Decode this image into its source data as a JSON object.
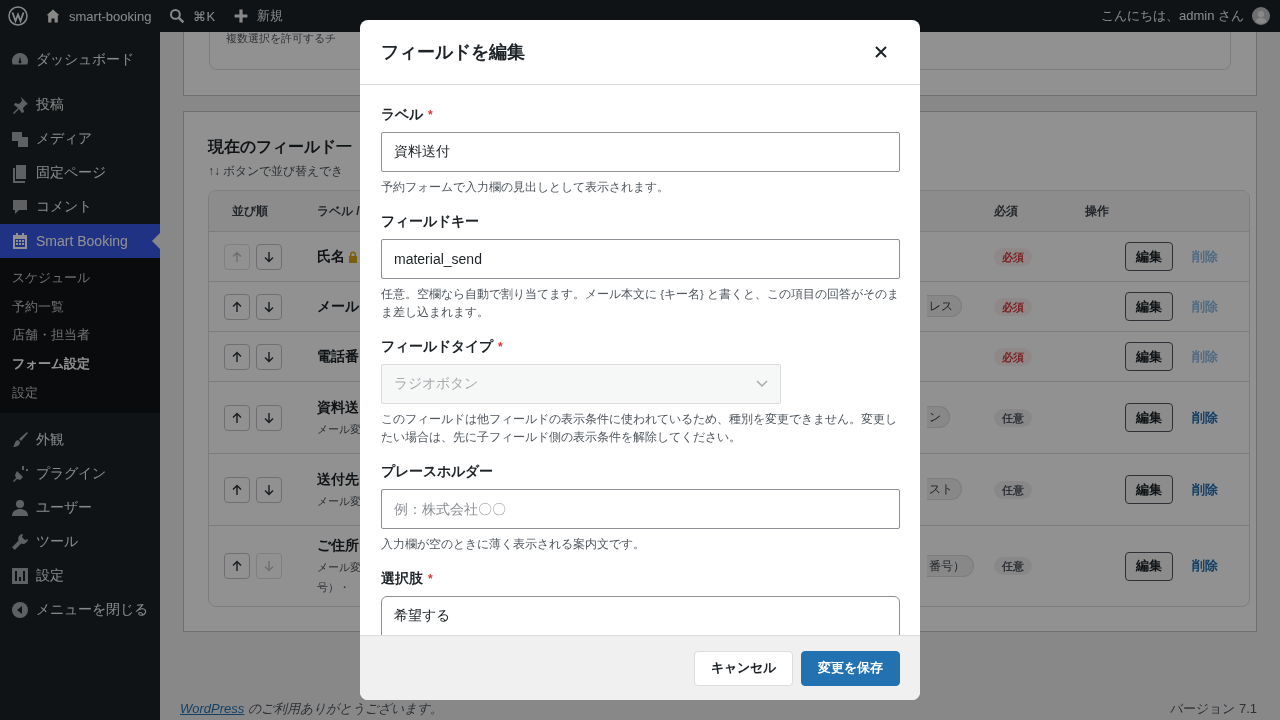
{
  "admin_bar": {
    "site_name": "smart-booking",
    "search_shortcut": "⌘K",
    "new_label": "新規",
    "greeting": "こんにちは、admin さん"
  },
  "sidebar": {
    "items": [
      {
        "label": "ダッシュボード",
        "selected": false
      },
      {
        "label": "投稿",
        "selected": false
      },
      {
        "label": "メディア",
        "selected": false
      },
      {
        "label": "固定ページ",
        "selected": false
      },
      {
        "label": "コメント",
        "selected": false
      },
      {
        "label": "Smart Booking",
        "selected": true,
        "children": [
          {
            "label": "スケジュール",
            "selected": false
          },
          {
            "label": "予約一覧",
            "selected": false
          },
          {
            "label": "店舗・担当者",
            "selected": false
          },
          {
            "label": "フォーム設定",
            "selected": true
          },
          {
            "label": "設定",
            "selected": false
          }
        ]
      },
      {
        "label": "外観",
        "selected": false
      },
      {
        "label": "プラグイン",
        "selected": false
      },
      {
        "label": "ユーザー",
        "selected": false
      },
      {
        "label": "ツール",
        "selected": false
      },
      {
        "label": "設定",
        "selected": false
      }
    ],
    "collapse_label": "メニューを閉じる"
  },
  "content": {
    "top_card_text": "複数選択を許可するチ",
    "fields_card": {
      "title": "現在のフィールド一",
      "subtitle": "↑↓ ボタンで並び替えでき",
      "columns": [
        "並び順",
        "ラベル /",
        "必須",
        "操作"
      ],
      "rows": [
        {
          "up_disabled": true,
          "down_disabled": false,
          "label": "氏名",
          "locked": true,
          "required": true,
          "required_label": "必須",
          "edit_label": "編集",
          "delete_label": "削除",
          "delete_disabled": true
        },
        {
          "up_disabled": false,
          "down_disabled": false,
          "label": "メール",
          "locked": false,
          "type_badge": "レス",
          "required": true,
          "required_label": "必須",
          "edit_label": "編集",
          "delete_label": "削除",
          "delete_disabled": true
        },
        {
          "up_disabled": false,
          "down_disabled": false,
          "label": "電話番",
          "locked": false,
          "required": true,
          "required_label": "必須",
          "edit_label": "編集",
          "delete_label": "削除",
          "delete_disabled": true
        },
        {
          "up_disabled": false,
          "down_disabled": false,
          "label": "資料送",
          "locked": false,
          "notes": [
            "メール変"
          ],
          "type_badge": "ン",
          "required": false,
          "required_label": "任意",
          "edit_label": "編集",
          "delete_label": "削除",
          "delete_disabled": false
        },
        {
          "up_disabled": false,
          "down_disabled": false,
          "label": "送付先",
          "locked": false,
          "notes": [
            "メール変"
          ],
          "type_badge": "スト",
          "required": false,
          "required_label": "任意",
          "edit_label": "編集",
          "delete_label": "削除",
          "delete_disabled": false
        },
        {
          "up_disabled": false,
          "down_disabled": true,
          "label": "ご住所",
          "locked": false,
          "notes": [
            "メール変",
            "号）・"
          ],
          "type_badge": "番号）",
          "required": false,
          "required_label": "任意",
          "edit_label": "編集",
          "delete_label": "削除",
          "delete_disabled": false
        }
      ]
    }
  },
  "footer": {
    "thanks_link": "WordPress",
    "thanks_text": " のご利用ありがとうございます。",
    "version": "バージョン 7.1"
  },
  "modal": {
    "title": "フィールドを編集",
    "fields": [
      {
        "kind": "text",
        "label": "ラベル",
        "required_mark": "*",
        "value": "資料送付",
        "help": "予約フォームで入力欄の見出しとして表示されます。"
      },
      {
        "kind": "text",
        "label": "フィールドキー",
        "value": "material_send",
        "help": "任意。空欄なら自動で割り当てます。メール本文に {キー名} と書くと、この項目の回答がそのまま差し込まれます。"
      },
      {
        "kind": "select",
        "label": "フィールドタイプ",
        "required_mark": "*",
        "value": "ラジオボタン",
        "disabled": true,
        "help": "このフィールドは他フィールドの表示条件に使われているため、種別を変更できません。変更したい場合は、先に子フィールド側の表示条件を解除してください。"
      },
      {
        "kind": "text",
        "label": "プレースホルダー",
        "placeholder": "例：株式会社〇〇",
        "help": "入力欄が空のときに薄く表示される案内文です。"
      },
      {
        "kind": "textarea",
        "label": "選択肢",
        "required_mark": "*",
        "lines": [
          "希望する"
        ]
      }
    ],
    "buttons": [
      {
        "label": "キャンセル",
        "kind": "secondary"
      },
      {
        "label": "変更を保存",
        "kind": "primary"
      }
    ]
  }
}
